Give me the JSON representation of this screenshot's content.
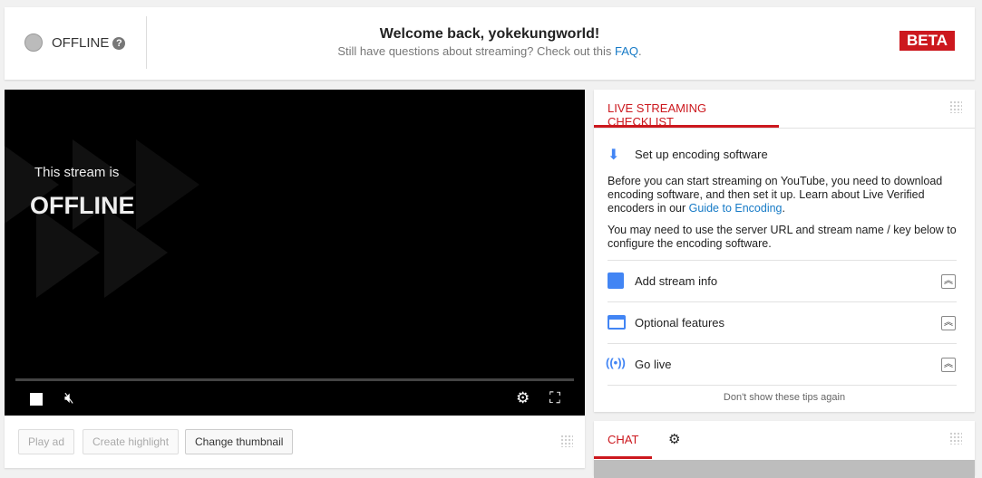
{
  "status": {
    "label": "OFFLINE",
    "help_icon": "question-circle-icon"
  },
  "header": {
    "welcome": "Welcome back, yokekungworld!",
    "sub_text": "Still have questions about streaming? Check out this",
    "faq_link": "FAQ",
    "sub_end": ".",
    "badge": "BETA"
  },
  "player": {
    "line1": "This stream is",
    "line2": "OFFLINE"
  },
  "actions": {
    "play_ad": "Play ad",
    "create_highlight": "Create highlight",
    "change_thumbnail": "Change thumbnail"
  },
  "checklist": {
    "tab": "LIVE STREAMING CHECKLIST",
    "step_title": "Set up encoding software",
    "para1": "Before you can start streaming on YouTube, you need to download encoding software, and then set it up. Learn about Live Verified encoders in our",
    "para1_link": "Guide to Encoding",
    "para1_end": ".",
    "para2": "You may need to use the server URL and stream name / key below to configure the encoding software.",
    "items": [
      {
        "label": "Add stream info",
        "icon": "bar-chart-icon"
      },
      {
        "label": "Optional features",
        "icon": "card-icon"
      },
      {
        "label": "Go live",
        "icon": "broadcast-icon"
      }
    ],
    "dismiss": "Don't show these tips again"
  },
  "chat": {
    "tab": "CHAT"
  },
  "colors": {
    "accent": "#cc181e",
    "link": "#167ac6",
    "icon_blue": "#4285f4"
  }
}
